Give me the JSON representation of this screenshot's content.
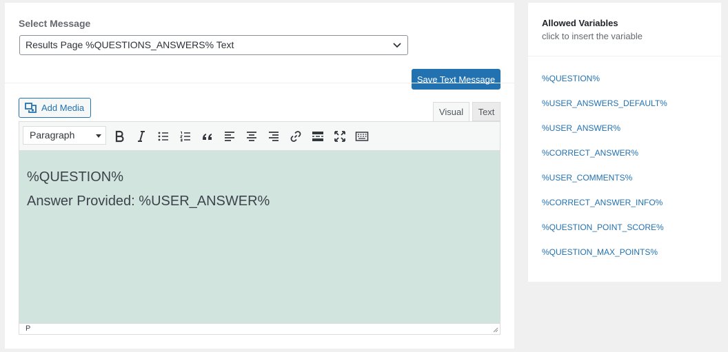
{
  "message_section": {
    "label": "Select Message",
    "selected": "Results Page %QUESTIONS_ANSWERS% Text",
    "save_label": "Save Text Message"
  },
  "editor": {
    "add_media_label": "Add Media",
    "tabs": {
      "visual": "Visual",
      "text": "Text"
    },
    "format_select": "Paragraph",
    "toolbar_icons": [
      "bold-icon",
      "italic-icon",
      "bullet-list-icon",
      "numbered-list-icon",
      "blockquote-icon",
      "align-left-icon",
      "align-center-icon",
      "align-right-icon",
      "link-icon",
      "read-more-icon",
      "fullscreen-icon",
      "toolbar-toggle-icon"
    ],
    "content": [
      "%QUESTION%",
      "Answer Provided: %USER_ANSWER%"
    ],
    "status_path": "P",
    "content_bg": "#d2e4de"
  },
  "variables": {
    "title": "Allowed Variables",
    "subtitle": "click to insert the variable",
    "items": [
      "%QUESTION%",
      "%USER_ANSWERS_DEFAULT%",
      "%USER_ANSWER%",
      "%CORRECT_ANSWER%",
      "%USER_COMMENTS%",
      "%CORRECT_ANSWER_INFO%",
      "%QUESTION_POINT_SCORE%",
      "%QUESTION_MAX_POINTS%"
    ]
  },
  "colors": {
    "accent": "#2271b1",
    "page_bg": "#f0f0f1"
  }
}
